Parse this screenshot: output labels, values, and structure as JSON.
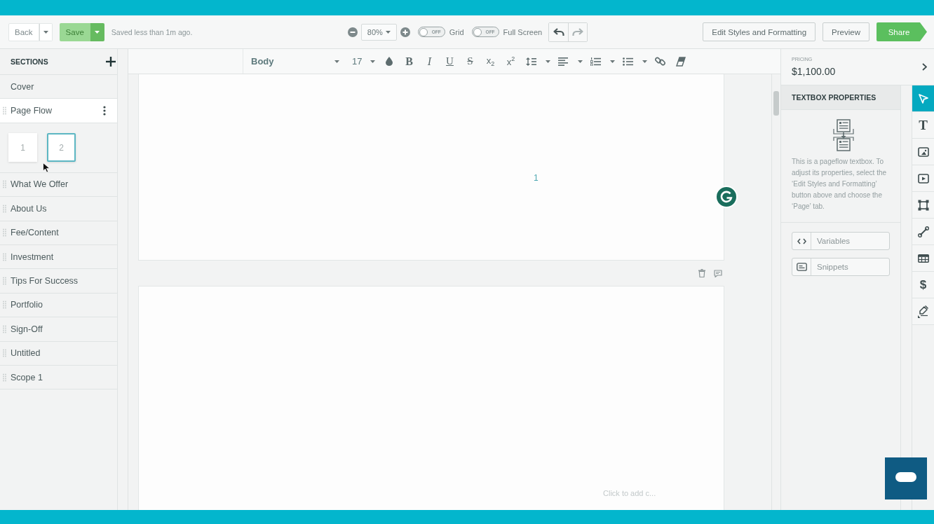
{
  "top_bar": {
    "back_button": "Back",
    "save_button": {
      "label": "Save",
      "disabled": true
    },
    "save_status": "Saved less than 1m ago.",
    "zoom": "80%",
    "toggles": [
      {
        "switch_text": "OFF",
        "label": "Grid",
        "on": false
      },
      {
        "switch_text": "OFF",
        "label": "Full Screen",
        "on": false
      }
    ],
    "history": [
      {
        "kind": "undo",
        "disabled": false
      },
      {
        "kind": "redo",
        "disabled": true
      }
    ],
    "actions": [
      {
        "kind": "edit_styles",
        "label": "Edit Styles and Formatting"
      },
      {
        "kind": "preview",
        "label": "Preview"
      },
      {
        "kind": "share",
        "label": "Share"
      }
    ]
  },
  "sidebar": {
    "title": "SECTIONS",
    "items": [
      {
        "label": "Cover",
        "draggable": false,
        "selected": false
      },
      {
        "label": "Page Flow",
        "draggable": true,
        "selected": true,
        "pages": [
          {
            "label": "1",
            "selected": false
          },
          {
            "label": "2",
            "selected": true
          }
        ]
      },
      {
        "label": "What We Offer",
        "draggable": true,
        "selected": false
      },
      {
        "label": "About Us",
        "draggable": true,
        "selected": false
      },
      {
        "label": "Fee/Content",
        "draggable": true,
        "selected": false
      },
      {
        "label": "Investment",
        "draggable": true,
        "selected": false
      },
      {
        "label": "Tips For Success",
        "draggable": true,
        "selected": false
      },
      {
        "label": "Portfolio",
        "draggable": true,
        "selected": false
      },
      {
        "label": "Sign-Off",
        "draggable": true,
        "selected": false
      },
      {
        "label": "Untitled",
        "draggable": true,
        "selected": false
      },
      {
        "label": "Scope 1",
        "draggable": true,
        "selected": false
      }
    ]
  },
  "format_toolbar": {
    "style": "Body",
    "font_size": "17",
    "tools": [
      {
        "kind": "color",
        "has_menu": false
      },
      {
        "kind": "bold",
        "glyph": "B",
        "has_menu": false
      },
      {
        "kind": "italic",
        "glyph": "I",
        "has_menu": false
      },
      {
        "kind": "underline",
        "glyph": "U",
        "has_menu": false
      },
      {
        "kind": "strikethrough",
        "glyph": "S",
        "has_menu": false
      },
      {
        "kind": "subscript",
        "glyph": "x$_{2}$",
        "has_menu": false
      },
      {
        "kind": "superscript",
        "glyph": "x$^{2}$",
        "has_menu": false
      },
      {
        "kind": "line_spacing",
        "has_menu": true
      },
      {
        "kind": "align",
        "has_menu": true
      },
      {
        "kind": "numbered_list",
        "has_menu": true
      },
      {
        "kind": "bullet_list",
        "has_menu": true
      },
      {
        "kind": "link",
        "has_menu": false
      },
      {
        "kind": "clear_format",
        "has_menu": false
      }
    ]
  },
  "document": {
    "pages": [
      {
        "label": "1"
      },
      {
        "placeholder": "Click to add c..."
      }
    ]
  },
  "pricing": {
    "label": "PRICING",
    "amount": "$1,100.00"
  },
  "properties_panel": {
    "title": "TEXTBOX PROPERTIES",
    "description": "This is a pageflow textbox. To adjust its properties, select the ‘Edit Styles and Formatting’ button above and choose the ‘Page’ tab.",
    "buttons": [
      {
        "kind": "variables",
        "label": "Variables"
      },
      {
        "kind": "snippets",
        "label": "Snippets"
      }
    ]
  },
  "tool_rail": [
    {
      "kind": "select",
      "selected": true
    },
    {
      "kind": "text",
      "glyph": "T",
      "selected": false
    },
    {
      "kind": "image",
      "selected": false
    },
    {
      "kind": "video",
      "selected": false
    },
    {
      "kind": "shape",
      "selected": false
    },
    {
      "kind": "line",
      "selected": false
    },
    {
      "kind": "table",
      "selected": false
    },
    {
      "kind": "pricing",
      "glyph": "$",
      "selected": false
    },
    {
      "kind": "signature",
      "selected": false
    }
  ]
}
